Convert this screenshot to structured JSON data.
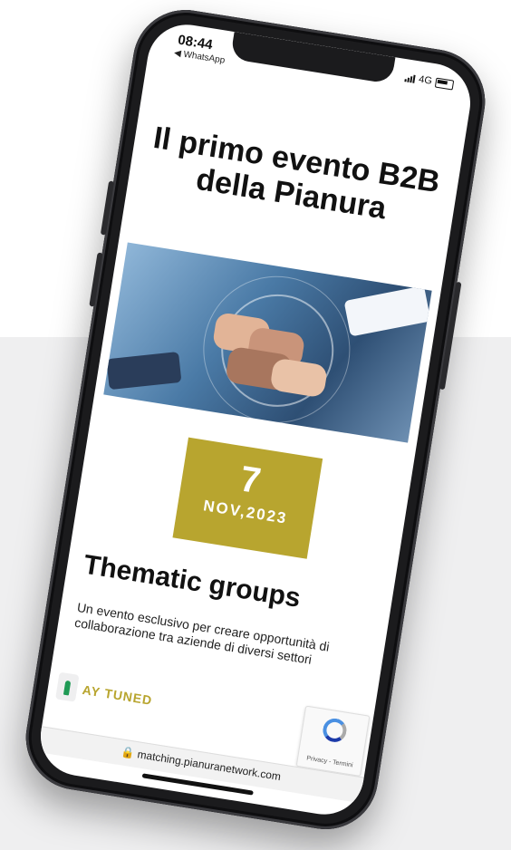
{
  "status": {
    "time": "08:44",
    "back_label": "◀ WhatsApp",
    "network": "4G"
  },
  "page": {
    "headline": "Il primo evento B2B della Pianura",
    "event_day": "7",
    "event_month_year": "NOV,2023",
    "section_title": "Thematic groups",
    "description": "Un evento esclusivo per creare opportunità di collaborazione tra aziende di diversi settori",
    "stay_tuned": "AY TUNED"
  },
  "recaptcha": {
    "links": "Privacy - Termini"
  },
  "browser": {
    "url": "matching.pianuranetwork.com"
  },
  "colors": {
    "accent": "#b8a52f",
    "background_panel": "#efeff0"
  }
}
